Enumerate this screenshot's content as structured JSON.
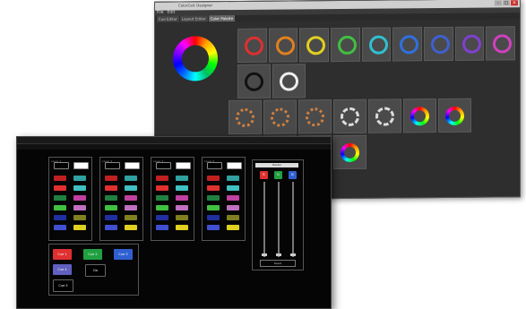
{
  "back_window": {
    "title": "ColorCalc Designer",
    "menu": [
      "File",
      "Edit"
    ],
    "tabs": [
      "Cue Editor",
      "Layout Editor",
      "Color Palette"
    ],
    "window_buttons": {
      "minimize": "–",
      "maximize": "□",
      "close": "×"
    }
  },
  "back_rows": [
    {
      "swatches": [
        {
          "type": "ring",
          "color": "#e03030"
        },
        {
          "type": "ring",
          "color": "#e08020"
        },
        {
          "type": "ring",
          "color": "#e0d020"
        },
        {
          "type": "ring",
          "color": "#40c040"
        },
        {
          "type": "ring",
          "color": "#30c0d0"
        },
        {
          "type": "ring",
          "color": "#3070e0"
        },
        {
          "type": "ring",
          "color": "#4060d0"
        },
        {
          "type": "ring",
          "color": "#8040d0"
        },
        {
          "type": "ring",
          "color": "#d040c0"
        }
      ]
    },
    {
      "swatches": [
        {
          "type": "ring",
          "color": "#111111"
        },
        {
          "type": "ring",
          "color": "#eeeeee"
        }
      ]
    },
    {
      "swatches": [
        {
          "type": "dots",
          "color": "#d08040"
        },
        {
          "type": "dots",
          "color": "#d08040"
        },
        {
          "type": "dots",
          "color": "#d08040"
        },
        {
          "type": "bw",
          "color": "#dddddd"
        },
        {
          "type": "bw",
          "color": "#dddddd"
        },
        {
          "type": "multi",
          "color": ""
        },
        {
          "type": "multi",
          "color": ""
        }
      ]
    },
    {
      "swatches": [
        {
          "type": "ring",
          "color": "#111111"
        },
        {
          "type": "ring",
          "color": "#e03030"
        },
        {
          "type": "ring",
          "color": "#111111"
        },
        {
          "type": "multi",
          "color": ""
        }
      ]
    }
  ],
  "front_window": {
    "title": "",
    "toolbar": []
  },
  "banks": [
    {
      "header": "Layer 1"
    },
    {
      "header": "Layer 2"
    },
    {
      "header": "Layer 3"
    },
    {
      "header": "Layer 4"
    }
  ],
  "bank_colors": [
    [
      "#c02020",
      "#30a0a0"
    ],
    [
      "#e03030",
      "#40c0c0"
    ],
    [
      "#208040",
      "#c040a0"
    ],
    [
      "#40c040",
      "#c070c0"
    ],
    [
      "#2030a0",
      "#808020"
    ],
    [
      "#4050d0",
      "#e0d020"
    ]
  ],
  "cues": [
    {
      "label": "Cue 1",
      "color": "#e03030"
    },
    {
      "label": "Cue 2",
      "color": "#20a040"
    },
    {
      "label": "Cue 3",
      "color": "#3060d0"
    },
    {
      "label": "Cue 4",
      "color": "#6060c0"
    },
    {
      "label": "Go",
      "color": "#000000"
    },
    {
      "label": "Cue 5",
      "color": "#000000"
    }
  ],
  "fader": {
    "header": "Master",
    "buttons": [
      {
        "label": "R",
        "color": "#e03030"
      },
      {
        "label": "G",
        "color": "#20a040"
      },
      {
        "label": "B",
        "color": "#3060d0"
      }
    ],
    "footer": "Reset"
  },
  "colors": {
    "app_bg": "#050505",
    "panel_bg": "#2e2e2e"
  }
}
